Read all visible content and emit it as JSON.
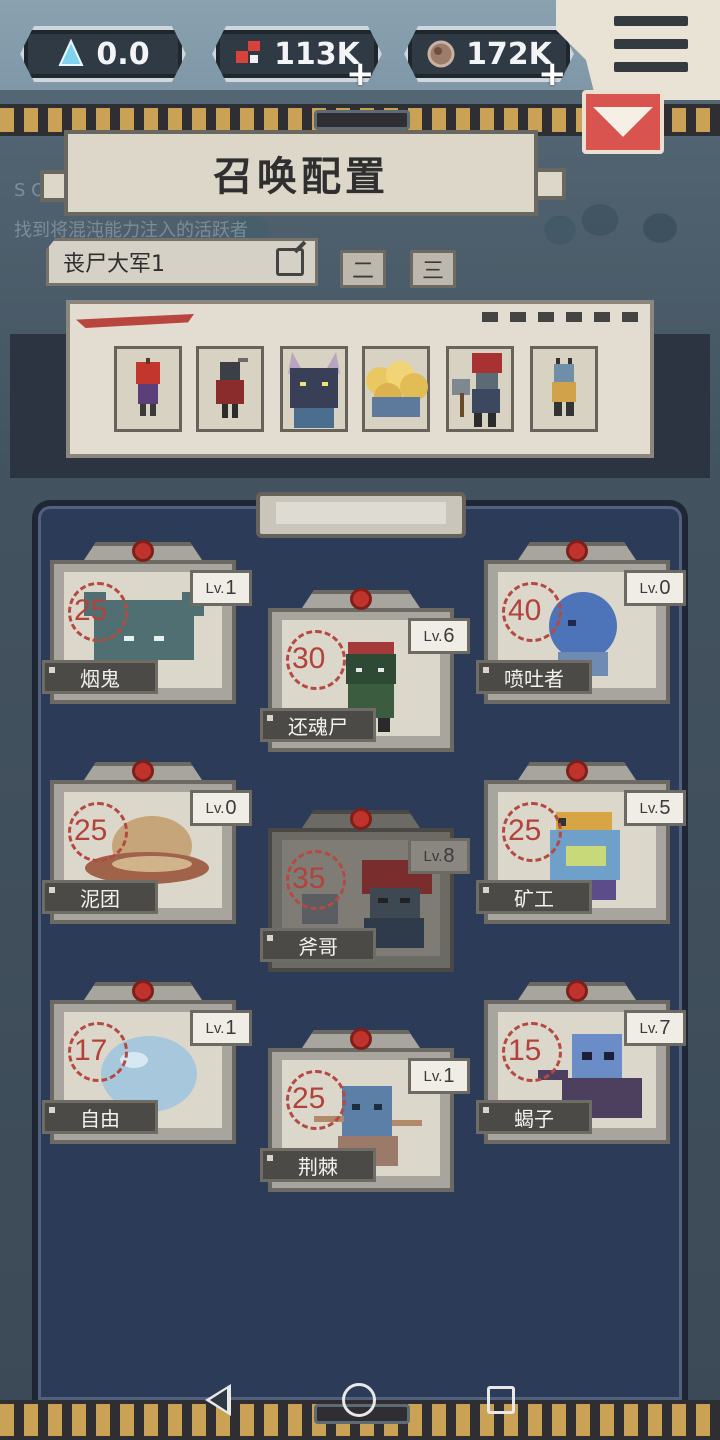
{
  "resources": {
    "shards": "0.0",
    "blood": "113K",
    "flesh": "172K",
    "plus": "+"
  },
  "background_text": {
    "line1": "S O",
    "line2": "找到将混沌能力注入的活跃者"
  },
  "header": {
    "title": "召唤配置"
  },
  "preset": {
    "name": "丧尸大军1",
    "tab2": "二",
    "tab3": "三"
  },
  "roster": {
    "units": [
      {
        "name": "烟鬼",
        "cost": "25",
        "level": "1"
      },
      {
        "name": "还魂尸",
        "cost": "30",
        "level": "6"
      },
      {
        "name": "喷吐者",
        "cost": "40",
        "level": "0"
      },
      {
        "name": "泥团",
        "cost": "25",
        "level": "0"
      },
      {
        "name": "斧哥",
        "cost": "35",
        "level": "8"
      },
      {
        "name": "矿工",
        "cost": "25",
        "level": "5"
      },
      {
        "name": "自由",
        "cost": "17",
        "level": "1"
      },
      {
        "name": "荆棘",
        "cost": "25",
        "level": "1"
      },
      {
        "name": "蝎子",
        "cost": "15",
        "level": "7"
      }
    ],
    "level_prefix": "Lv."
  },
  "colors": {
    "accent_red": "#d9534f",
    "cost_red": "#b2423a",
    "panel_navy": "#2c3b58",
    "hazard_gold": "#caa256"
  }
}
